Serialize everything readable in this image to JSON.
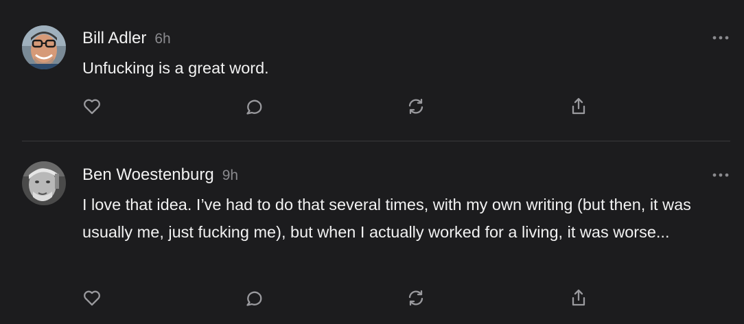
{
  "posts": [
    {
      "author": "Bill Adler",
      "time": "6h",
      "text": "Unfucking is a great word.",
      "avatar_icon": "user-photo-glasses",
      "actions": [
        "heart-icon",
        "comment-icon",
        "restack-icon",
        "share-icon"
      ],
      "menu_icon": "more-options-icon"
    },
    {
      "author": "Ben Woestenburg",
      "time": "9h",
      "text": "I love that idea. I’ve had to do that several times, with my own writing (but then, it was usually me, just fucking me), but when I actually worked for a living, it was worse...",
      "avatar_icon": "user-photo-grayscale",
      "actions": [
        "heart-icon",
        "comment-icon",
        "restack-icon",
        "share-icon"
      ],
      "menu_icon": "more-options-icon"
    }
  ],
  "colors": {
    "background": "#1c1c1e",
    "text": "#f2f2f2",
    "muted": "#8a8a8e",
    "icon": "#9a9a9e",
    "divider": "#3a3a3c"
  }
}
